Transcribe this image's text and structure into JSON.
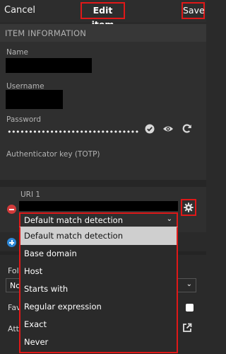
{
  "header": {
    "cancel_label": "Cancel",
    "title": "Edit item",
    "save_label": "Save"
  },
  "item_information": {
    "heading": "ITEM INFORMATION",
    "name_label": "Name",
    "username_label": "Username",
    "password_label": "Password",
    "password_masked": "•••••••••••••••••••••••••••••••",
    "totp_label": "Authenticator key (TOTP)"
  },
  "uri": {
    "label": "URI 1",
    "match_detection_selected": "Default match detection",
    "match_options": [
      "Default match detection",
      "Base domain",
      "Host",
      "Starts with",
      "Regular expression",
      "Exact",
      "Never"
    ]
  },
  "lower": {
    "folder_label_partial": "Fold",
    "folder_value_partial": "No",
    "favorite_label_partial": "Fav",
    "attachments_label_partial": "Atta"
  },
  "icons": {
    "check": "check-circle-icon",
    "eye": "eye-icon",
    "generate": "refresh-icon",
    "gear": "gear-icon",
    "remove": "minus-circle-icon",
    "add": "plus-circle-icon",
    "external": "external-link-icon"
  },
  "colors": {
    "highlight_border": "#e01818",
    "remove_red": "#d33b3b",
    "add_blue": "#2d87d6",
    "selected_option": "#cfcfcf"
  }
}
